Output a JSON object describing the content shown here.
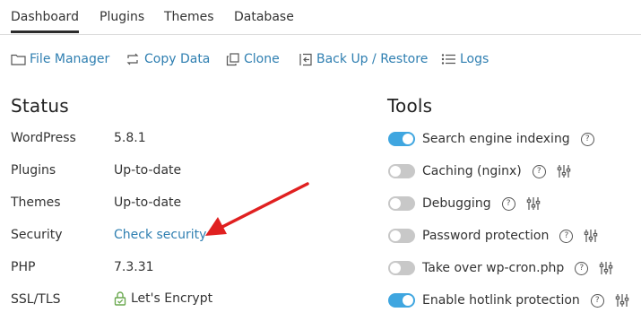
{
  "tabs": [
    "Dashboard",
    "Plugins",
    "Themes",
    "Database"
  ],
  "actions": {
    "file_manager": "File Manager",
    "copy_data": "Copy Data",
    "clone": "Clone",
    "backup": "Back Up / Restore",
    "logs": "Logs"
  },
  "status": {
    "title": "Status",
    "rows": [
      {
        "label": "WordPress",
        "value": "5.8.1"
      },
      {
        "label": "Plugins",
        "value": "Up-to-date"
      },
      {
        "label": "Themes",
        "value": "Up-to-date"
      },
      {
        "label": "Security",
        "value": "Check security"
      },
      {
        "label": "PHP",
        "value": "7.3.31"
      },
      {
        "label": "SSL/TLS",
        "value": "Let's Encrypt"
      }
    ]
  },
  "tools": {
    "title": "Tools",
    "rows": [
      {
        "label": "Search engine indexing",
        "enabled": true
      },
      {
        "label": "Caching (nginx)",
        "enabled": false
      },
      {
        "label": "Debugging",
        "enabled": false
      },
      {
        "label": "Password protection",
        "enabled": false
      },
      {
        "label": "Take over wp-cron.php",
        "enabled": false
      },
      {
        "label": "Enable hotlink protection",
        "enabled": true
      }
    ],
    "help_glyph": "?"
  },
  "colors": {
    "link": "#2f7fb1",
    "toggle_on": "#3fa6e0",
    "toggle_off": "#c8c8c8",
    "annotation_arrow": "#e02020",
    "ssl_icon": "#6aa84f"
  }
}
